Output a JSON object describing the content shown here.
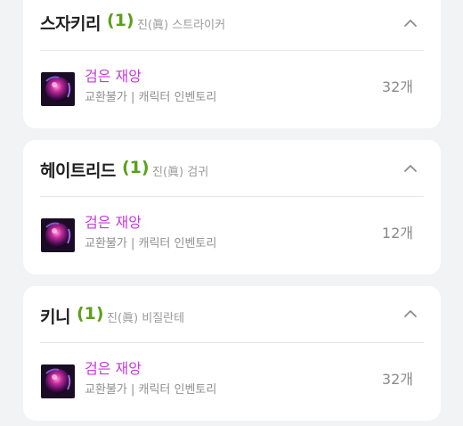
{
  "colors": {
    "background": "#f2f3f5",
    "card": "#ffffff",
    "count_green": "#5aa11a",
    "item_name_purple": "#c33ad8",
    "muted_text": "#9a9a9a"
  },
  "characters": [
    {
      "name": "스자키리",
      "count": "(1)",
      "class": "진(眞) 스트라이커",
      "chevron_icon": "chevron-up-icon",
      "items": [
        {
          "name": "검은 재앙",
          "meta": "교환불가 | 캐릭터 인벤토리",
          "quantity": "32개",
          "icon": "black-calamity-orb-icon"
        }
      ]
    },
    {
      "name": "헤이트리드",
      "count": "(1)",
      "class": "진(眞) 검귀",
      "chevron_icon": "chevron-up-icon",
      "items": [
        {
          "name": "검은 재앙",
          "meta": "교환불가 | 캐릭터 인벤토리",
          "quantity": "12개",
          "icon": "black-calamity-orb-icon"
        }
      ]
    },
    {
      "name": "키니",
      "count": "(1)",
      "class": "진(眞) 비질란테",
      "chevron_icon": "chevron-up-icon",
      "items": [
        {
          "name": "검은 재앙",
          "meta": "교환불가 | 캐릭터 인벤토리",
          "quantity": "32개",
          "icon": "black-calamity-orb-icon"
        }
      ]
    }
  ]
}
